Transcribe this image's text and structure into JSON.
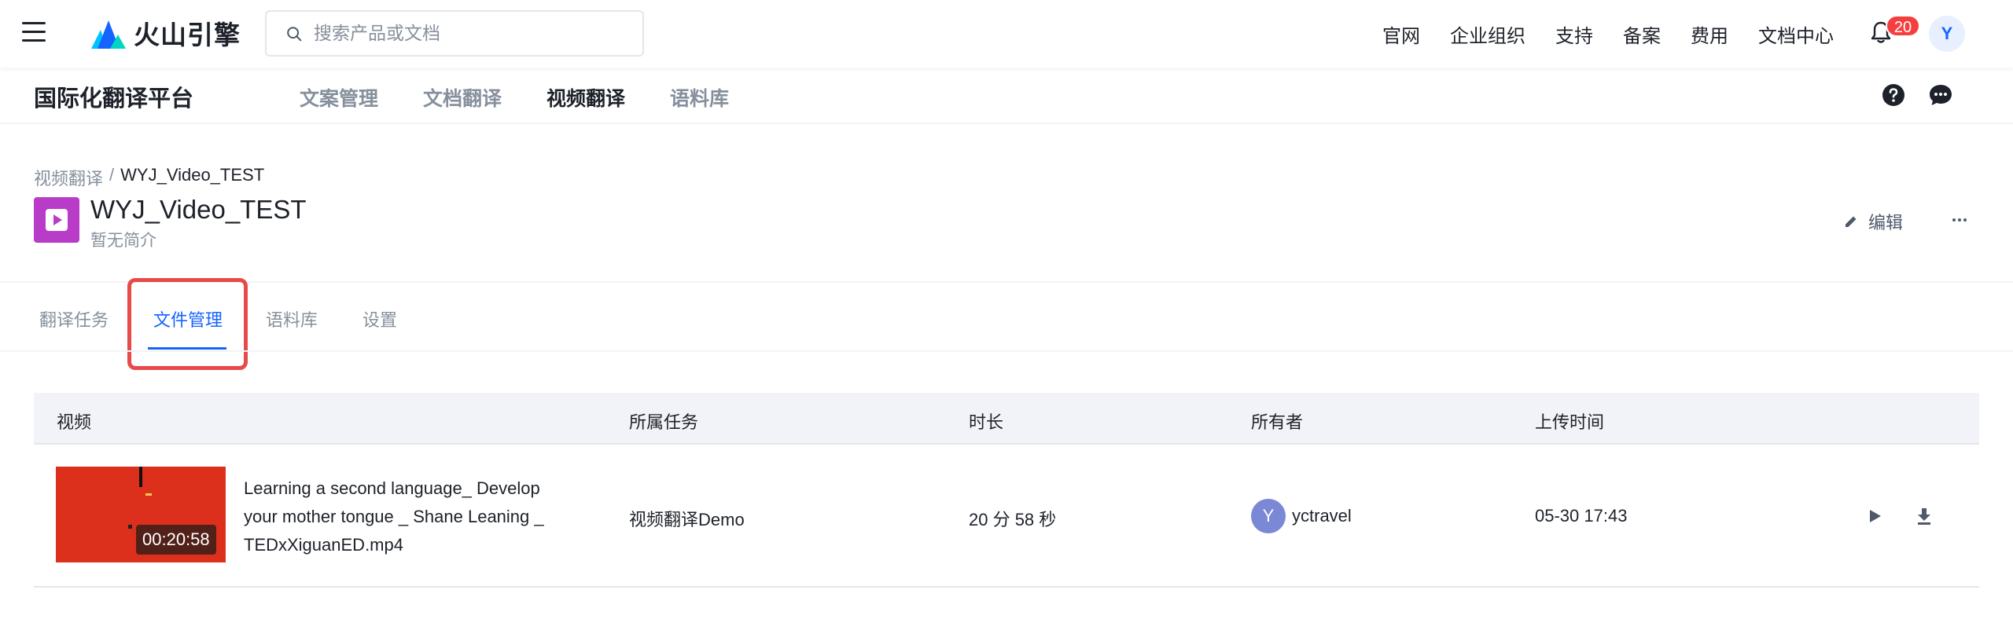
{
  "header": {
    "logo_text": "火山引擎",
    "search_placeholder": "搜索产品或文档",
    "nav": [
      "官网",
      "企业组织",
      "支持",
      "备案",
      "费用",
      "文档中心"
    ],
    "notification_count": "20",
    "user_initial": "Y"
  },
  "subheader": {
    "platform_title": "国际化翻译平台",
    "nav": [
      {
        "label": "文案管理",
        "active": false
      },
      {
        "label": "文档翻译",
        "active": false
      },
      {
        "label": "视频翻译",
        "active": true
      },
      {
        "label": "语料库",
        "active": false
      }
    ]
  },
  "project": {
    "breadcrumb_parent": "视频翻译",
    "breadcrumb_separator": "/",
    "breadcrumb_current": "WYJ_Video_TEST",
    "name": "WYJ_Video_TEST",
    "description": "暂无简介",
    "edit_label": "编辑"
  },
  "tabs": [
    {
      "label": "翻译任务",
      "active": false
    },
    {
      "label": "文件管理",
      "active": true
    },
    {
      "label": "语料库",
      "active": false
    },
    {
      "label": "设置",
      "active": false
    }
  ],
  "table": {
    "columns": [
      "视频",
      "所属任务",
      "时长",
      "所有者",
      "上传时间"
    ],
    "rows": [
      {
        "duration_tag": "00:20:58",
        "filename": "Learning a second language_ Develop your mother tongue _ Shane Leaning _ TEDxXiguanED.mp4",
        "task": "视频翻译Demo",
        "duration": "20 分 58 秒",
        "owner_initial": "Y",
        "owner": "yctravel",
        "upload_time": "05-30 17:43"
      }
    ]
  },
  "colors": {
    "accent": "#1664ff",
    "highlight_box": "#e84a4a",
    "project_icon": "#b83cc8",
    "badge": "#f53f3f",
    "thumbnail": "#dc2f1c"
  }
}
